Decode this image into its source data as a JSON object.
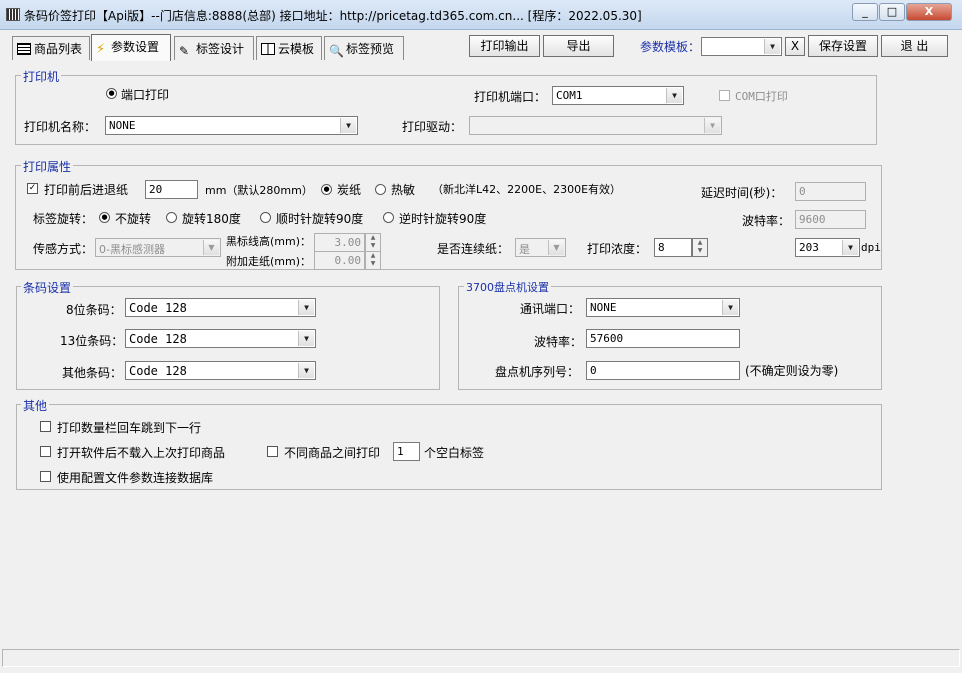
{
  "window": {
    "title": "条码价签打印【Api版】--门店信息:8888(总部) 接口地址：http://pricetag.td365.com.cn... [程序：2022.05.30]",
    "min": "_",
    "max": "□",
    "close": "X"
  },
  "tabs": [
    {
      "label": "商品列表",
      "icon": "grid-icon"
    },
    {
      "label": "参数设置",
      "icon": "lightning-icon"
    },
    {
      "label": "标签设计",
      "icon": "pencil-icon"
    },
    {
      "label": "云模板",
      "icon": "book-icon"
    },
    {
      "label": "标签预览",
      "icon": "magnifier-icon"
    }
  ],
  "toolbar": {
    "print": "打印输出",
    "export": "导出",
    "template_label": "参数模板：",
    "template_value": "",
    "clear": "X",
    "save": "保存设置",
    "exit": "退 出"
  },
  "printer": {
    "group": "打印机",
    "port_print": "端口打印",
    "port_label": "打印机端口：",
    "port_value": "COM1",
    "com_print": "COM口打印",
    "name_label": "打印机名称：",
    "name_value": "NONE",
    "driver_label": "打印驱动：",
    "driver_value": ""
  },
  "props": {
    "group": "打印属性",
    "feed_label": "打印前后进退纸",
    "feed_value": "20",
    "feed_unit": "mm（默认280mm）",
    "carbon": "炭纸",
    "thermal": "热敏",
    "note": "（新北洋L42、2200E、2300E有效）",
    "delay_label": "延迟时间(秒)：",
    "delay_value": "0",
    "rotate_label": "标签旋转：",
    "rot_none": "不旋转",
    "rot_180": "旋转180度",
    "rot_cw": "顺时针旋转90度",
    "rot_ccw": "逆时针旋转90度",
    "baud_label": "波特率：",
    "baud_value": "9600",
    "sensor_label": "传感方式：",
    "sensor_value": "0-黑标感测器",
    "mark_label": "黑标线高(mm)：",
    "mark_value": "3.00",
    "extra_label": "附加走纸(mm)：",
    "extra_value": "0.00",
    "continuous_label": "是否连续纸：",
    "continuous_value": "是",
    "density_label": "打印浓度：",
    "density_value": "8",
    "dpi_value": "203",
    "dpi_unit": "dpi"
  },
  "barcode": {
    "group": "条码设置",
    "b8_label": "8位条码：",
    "b8_value": "Code 128",
    "b13_label": "13位条码：",
    "b13_value": "Code 128",
    "other_label": "其他条码：",
    "other_value": "Code 128"
  },
  "inventory": {
    "group": "3700盘点机设置",
    "port_label": "通讯端口：",
    "port_value": "NONE",
    "baud_label": "波特率：",
    "baud_value": "57600",
    "serial_label": "盘点机序列号：",
    "serial_value": "0",
    "serial_hint": "(不确定则设为零)"
  },
  "other": {
    "group": "其他",
    "opt1": "打印数量栏回车跳到下一行",
    "opt2": "打开软件后不载入上次打印商品",
    "opt3_pre": "不同商品之间打印",
    "opt3_value": "1",
    "opt3_post": "个空白标签",
    "opt4": "使用配置文件参数连接数据库"
  }
}
